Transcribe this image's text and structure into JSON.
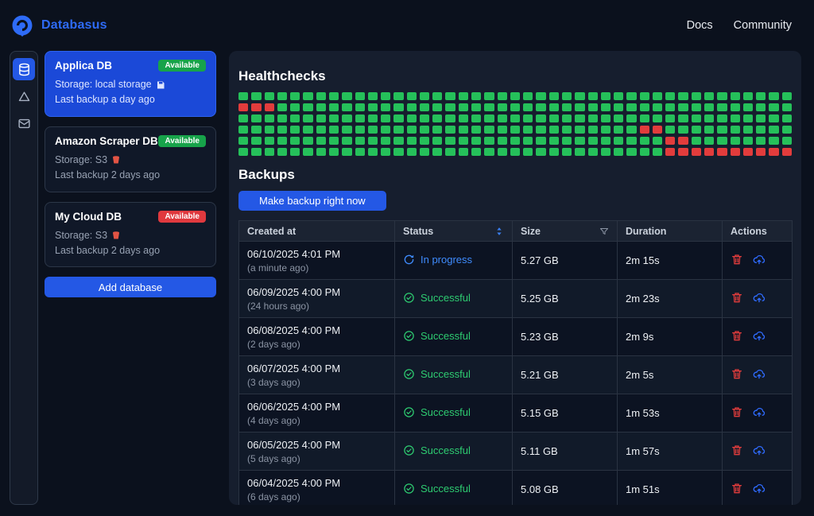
{
  "header": {
    "brand": "Databasus",
    "links": [
      {
        "label": "Docs"
      },
      {
        "label": "Community"
      }
    ]
  },
  "sidebar": {
    "items": [
      {
        "name": "databases",
        "selected": true
      },
      {
        "name": "storage",
        "selected": false
      },
      {
        "name": "notifications",
        "selected": false
      }
    ]
  },
  "databases": [
    {
      "name": "Applica DB",
      "badge": "Available",
      "badge_color": "#17a34a",
      "storage": "Storage: local storage",
      "storage_icon": "floppy-icon",
      "last_backup": "Last backup a day ago",
      "selected": true
    },
    {
      "name": "Amazon Scraper DB",
      "badge": "Available",
      "badge_color": "#17a34a",
      "storage": "Storage: S3",
      "storage_icon": "s3-bucket-icon",
      "last_backup": "Last backup 2 days ago",
      "selected": false
    },
    {
      "name": "My Cloud DB",
      "badge": "Available",
      "badge_color": "#e0393e",
      "storage": "Storage: S3",
      "storage_icon": "s3-bucket-icon",
      "last_backup": "Last backup 2 days ago",
      "selected": false
    }
  ],
  "add_database_label": "Add database",
  "healthchecks": {
    "title": "Healthchecks",
    "columns": 43,
    "rows": 6,
    "ok_color": "#25c05a",
    "fail_color": "#e23c3c",
    "failed_cells_by_row": [
      [],
      [
        0,
        1,
        2
      ],
      [],
      [
        31,
        32
      ],
      [
        33,
        34
      ],
      [
        33,
        34,
        35,
        36,
        37,
        38,
        39,
        40,
        41,
        42
      ]
    ]
  },
  "backups": {
    "title": "Backups",
    "make_backup_label": "Make backup right now",
    "table": {
      "columns": [
        "Created at",
        "Status",
        "Size",
        "Duration",
        "Actions"
      ],
      "rows": [
        {
          "created": "06/10/2025 4:01 PM",
          "ago": "(a minute ago)",
          "status": "In progress",
          "status_kind": "progress",
          "size": "5.27 GB",
          "duration": "2m 15s"
        },
        {
          "created": "06/09/2025 4:00 PM",
          "ago": "(24 hours ago)",
          "status": "Successful",
          "status_kind": "success",
          "size": "5.25 GB",
          "duration": "2m 23s"
        },
        {
          "created": "06/08/2025 4:00 PM",
          "ago": "(2 days ago)",
          "status": "Successful",
          "status_kind": "success",
          "size": "5.23 GB",
          "duration": "2m 9s"
        },
        {
          "created": "06/07/2025 4:00 PM",
          "ago": "(3 days ago)",
          "status": "Successful",
          "status_kind": "success",
          "size": "5.21 GB",
          "duration": "2m 5s"
        },
        {
          "created": "06/06/2025 4:00 PM",
          "ago": "(4 days ago)",
          "status": "Successful",
          "status_kind": "success",
          "size": "5.15 GB",
          "duration": "1m 53s"
        },
        {
          "created": "06/05/2025 4:00 PM",
          "ago": "(5 days ago)",
          "status": "Successful",
          "status_kind": "success",
          "size": "5.11 GB",
          "duration": "1m 57s"
        },
        {
          "created": "06/04/2025 4:00 PM",
          "ago": "(6 days ago)",
          "status": "Successful",
          "status_kind": "success",
          "size": "5.08 GB",
          "duration": "1m 51s"
        }
      ]
    }
  }
}
